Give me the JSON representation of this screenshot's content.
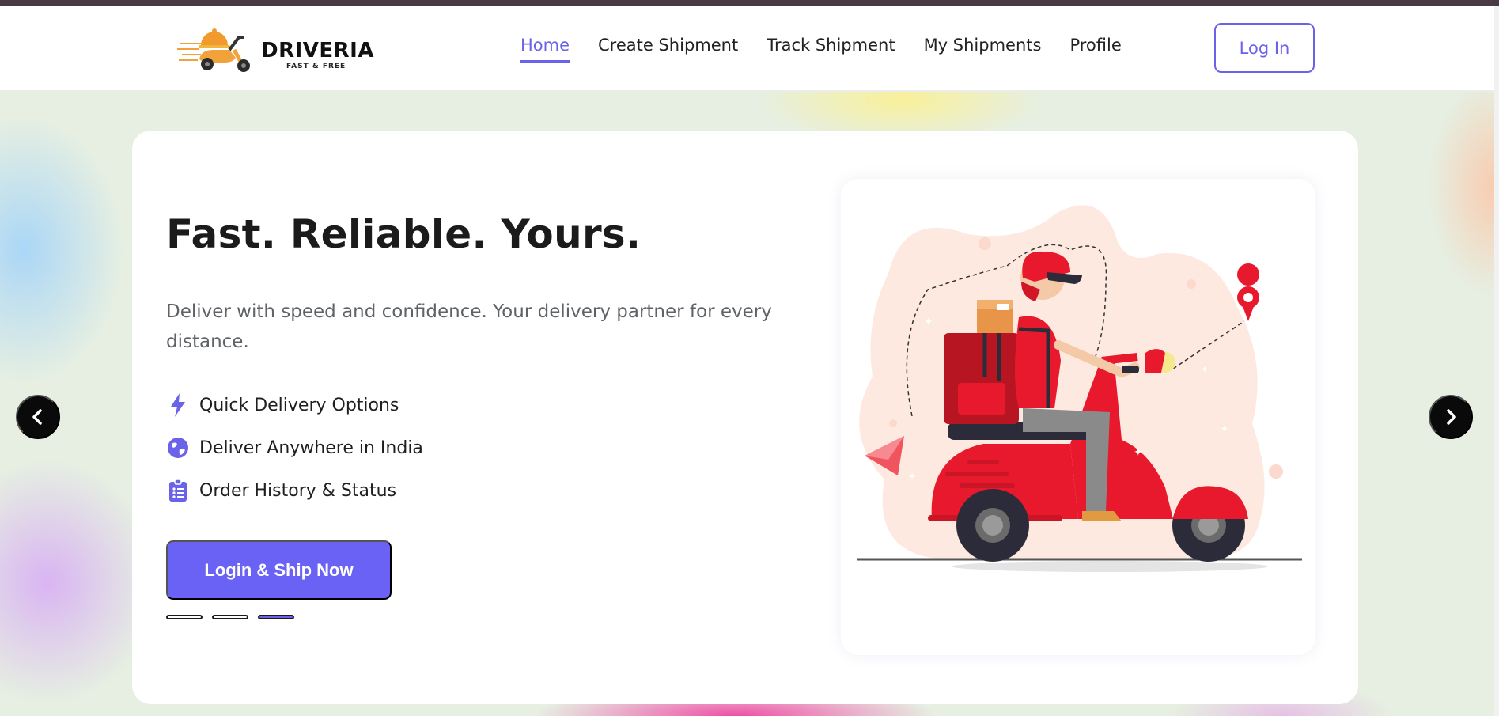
{
  "brand": {
    "name": "DRIVERIA",
    "tagline": "FAST & FREE",
    "accent_color": "#6a62e8"
  },
  "nav": {
    "links": [
      {
        "label": "Home",
        "active": true
      },
      {
        "label": "Create Shipment",
        "active": false
      },
      {
        "label": "Track Shipment",
        "active": false
      },
      {
        "label": "My Shipments",
        "active": false
      },
      {
        "label": "Profile",
        "active": false
      }
    ],
    "login_label": "Log In"
  },
  "hero": {
    "title": "Fast. Reliable. Yours.",
    "subtitle": "Deliver with speed and confidence. Your delivery partner for every distance.",
    "features": [
      {
        "icon": "lightning-icon",
        "label": "Quick Delivery Options"
      },
      {
        "icon": "globe-icon",
        "label": "Deliver Anywhere in India"
      },
      {
        "icon": "clipboard-list-icon",
        "label": "Order History & Status"
      }
    ],
    "cta_label": "Login & Ship Now",
    "carousel": {
      "slide_count": 3,
      "active_index": 2
    }
  },
  "illustration": {
    "subject": "delivery-scooter-illustration"
  },
  "carousel_controls": {
    "prev_icon": "chevron-left-icon",
    "next_icon": "chevron-right-icon"
  }
}
